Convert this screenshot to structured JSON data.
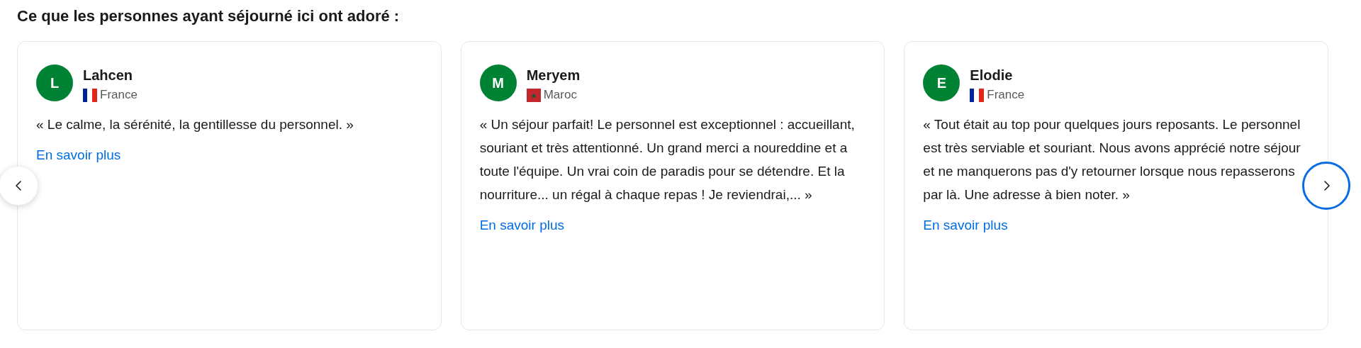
{
  "heading": "Ce que les personnes ayant séjourné ici ont adoré :",
  "reviews": [
    {
      "initial": "L",
      "name": "Lahcen",
      "country": {
        "name": "France",
        "kind": "fr"
      },
      "quote": "« Le calme, la sérénité, la gentillesse du personnel. »",
      "link": "En savoir plus"
    },
    {
      "initial": "M",
      "name": "Meryem",
      "country": {
        "name": "Maroc",
        "kind": "ma"
      },
      "quote": "« Un séjour parfait! Le personnel est exceptionnel : accueillant, souriant et très attentionné. Un grand merci a noureddine et a toute l'équipe. Un vrai coin de paradis pour se détendre. Et la nourriture... un régal à chaque repas ! Je reviendrai,... »",
      "link": "En savoir plus"
    },
    {
      "initial": "E",
      "name": "Elodie",
      "country": {
        "name": "France",
        "kind": "fr"
      },
      "quote": "« Tout était au top pour quelques jours reposants. Le personnel est très serviable et souriant. Nous avons apprécié notre séjour et ne manquerons pas d'y retourner lorsque nous repasserons par là. Une adresse à bien noter. »",
      "link": "En savoir plus"
    }
  ],
  "nav": [
    {
      "kind": "prev",
      "focused": false
    },
    {
      "kind": "next",
      "focused": true
    }
  ]
}
